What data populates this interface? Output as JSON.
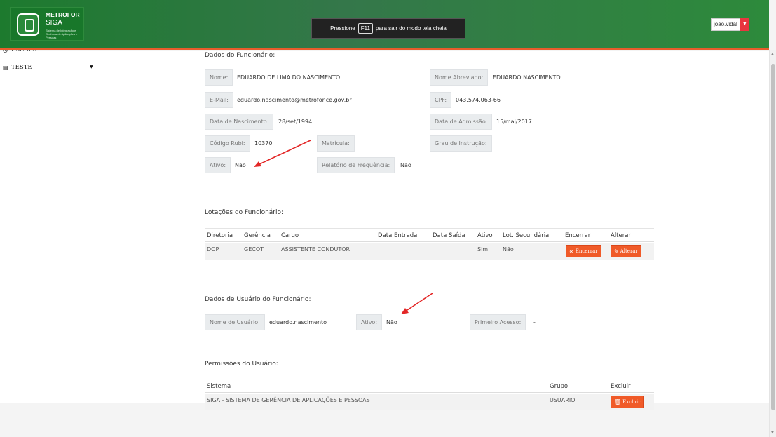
{
  "header": {
    "logo_title": "METROFOR",
    "logo_subtitle": "SIGA",
    "logo_desc": "Sistema de Integração e Gerência de Aplicações e Pessoas",
    "fullscreen_hint_prefix": "Pressione",
    "fullscreen_key": "F11",
    "fullscreen_hint_suffix": "para sair do modo tela cheia",
    "user_name": "joao.vidal"
  },
  "sidebar": {
    "items": [
      {
        "label": "ESCALA",
        "icon": "clock-icon"
      },
      {
        "label": "TESTE",
        "icon": "document-icon"
      }
    ]
  },
  "funcionario": {
    "section_title": "Dados do Funcionário:",
    "nome_label": "Nome:",
    "nome": "EDUARDO DE LIMA DO NASCIMENTO",
    "nome_abrev_label": "Nome Abreviado:",
    "nome_abrev": "EDUARDO NASCIMENTO",
    "email_label": "E-Mail:",
    "email": "eduardo.nascimento@metrofor.ce.gov.br",
    "cpf_label": "CPF:",
    "cpf": "043.574.063-66",
    "nascimento_label": "Data de Nascimento:",
    "nascimento": "28/set/1994",
    "admissao_label": "Data de Admissão:",
    "admissao": "15/mai/2017",
    "rubi_label": "Código Rubi:",
    "rubi": "10370",
    "matricula_label": "Matrícula:",
    "instrucao_label": "Grau de Instrução:",
    "ativo_label": "Ativo:",
    "ativo": "Não",
    "relatorio_label": "Relatório de Frequência:",
    "relatorio": "Não"
  },
  "lotacoes": {
    "section_title": "Lotações do Funcionário:",
    "headers": [
      "Diretoria",
      "Gerência",
      "Cargo",
      "Data Entrada",
      "Data Saída",
      "Ativo",
      "Lot. Secundária",
      "Encerrar",
      "Alterar"
    ],
    "rows": [
      {
        "diretoria": "DOP",
        "gerencia": "GECOT",
        "cargo": "ASSISTENTE CONDUTOR",
        "entrada": "",
        "saida": "",
        "ativo": "Sim",
        "secundaria": "Não",
        "encerrar": "Encerrar",
        "alterar": "Alterar"
      }
    ]
  },
  "usuario": {
    "section_title": "Dados de Usuário do Funcionário:",
    "nome_label": "Nome de Usuário:",
    "nome": "eduardo.nascimento",
    "ativo_label": "Ativo:",
    "ativo": "Não",
    "acesso_label": "Primeiro Acesso:",
    "acesso": "-"
  },
  "permissoes": {
    "section_title": "Permissões do Usuário:",
    "headers": [
      "Sistema",
      "Grupo",
      "Excluir"
    ],
    "rows": [
      {
        "sistema": "SIGA - SISTEMA DE GERÊNCIA DE APLICAÇÕES E PESSOAS",
        "grupo": "USUARIO",
        "excluir": "Excluir"
      }
    ]
  },
  "colors": {
    "header_green": "#2d7a3e",
    "accent_orange": "#f05a28",
    "annotation_red": "#e32626",
    "user_caret_red": "#e8363f"
  }
}
